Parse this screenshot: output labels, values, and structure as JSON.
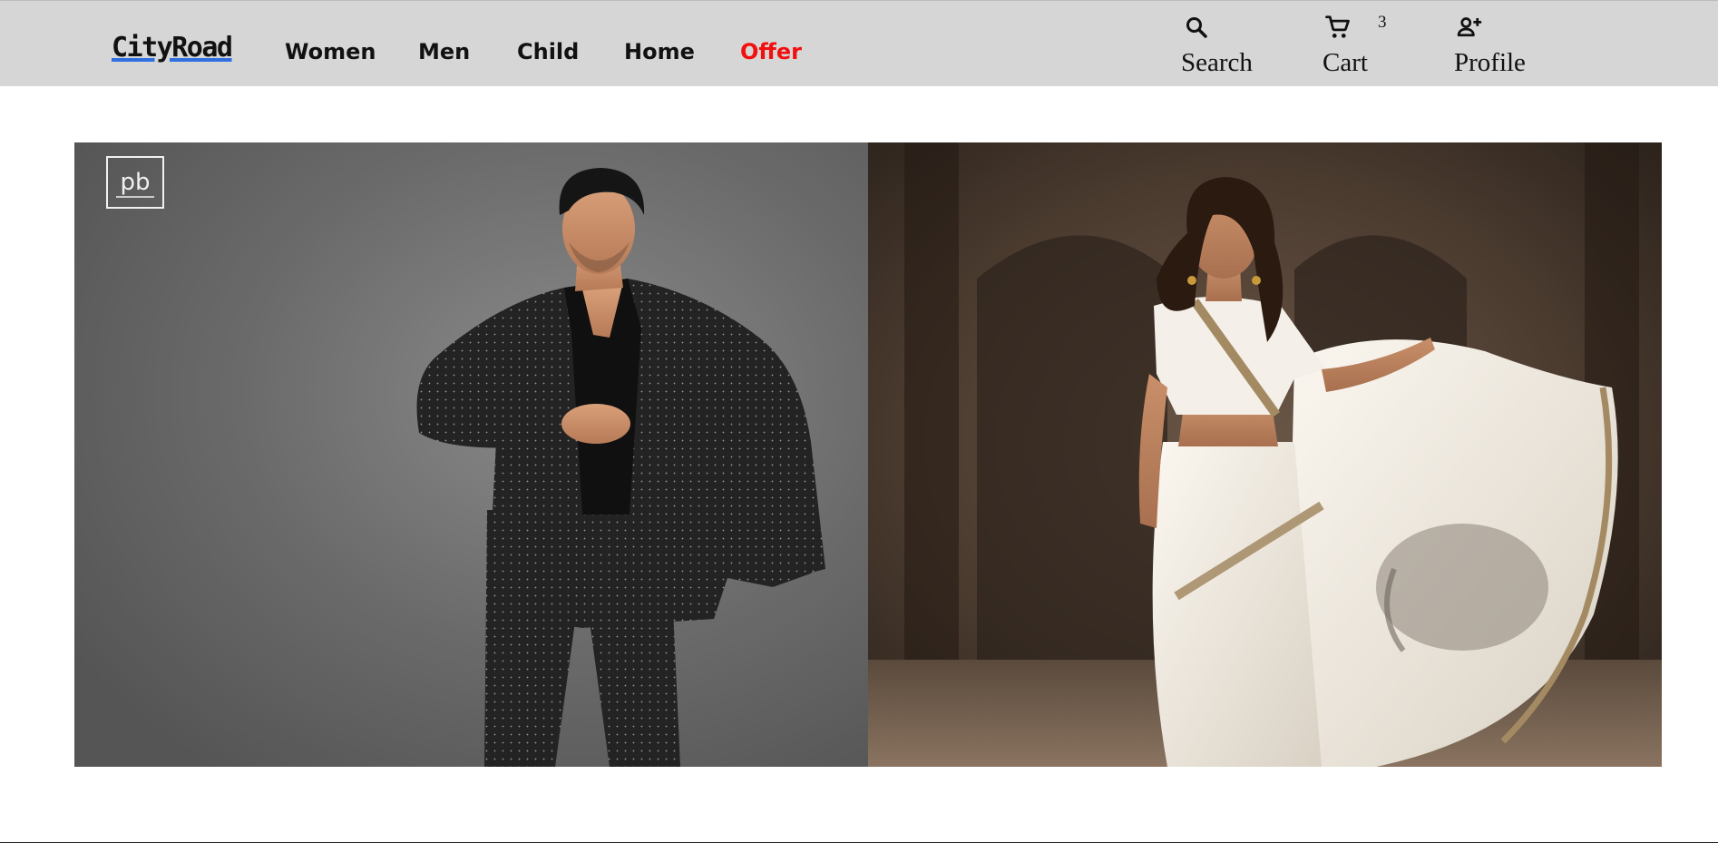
{
  "brand": {
    "logo_text": "CityRoad",
    "accent_color": "#2f6fe0"
  },
  "nav": {
    "links": [
      {
        "label": "Women"
      },
      {
        "label": "Men"
      },
      {
        "label": "Child"
      },
      {
        "label": "Home"
      },
      {
        "label": "Offer",
        "color": "#f20f0f"
      }
    ]
  },
  "actions": {
    "search": {
      "label": "Search",
      "icon": "search-icon"
    },
    "cart": {
      "label": "Cart",
      "icon": "cart-icon",
      "count": "3"
    },
    "profile": {
      "label": "Profile",
      "icon": "add-person-icon"
    }
  },
  "hero": {
    "panels": [
      {
        "subject": "man-in-black-polka-dot-suit"
      },
      {
        "subject": "woman-in-white-saree"
      }
    ],
    "watermark_text": "pb"
  },
  "colors": {
    "navbar_bg": "#d6d6d6",
    "offer": "#f20f0f"
  }
}
